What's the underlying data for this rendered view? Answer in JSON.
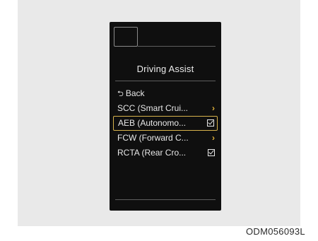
{
  "screen": {
    "title": "Driving Assist",
    "menu": [
      {
        "label": "Back",
        "icon": "back-arrow-icon",
        "trail": "none",
        "selected": false
      },
      {
        "label": "SCC (Smart Crui...",
        "trail": "chevron",
        "selected": false
      },
      {
        "label": "AEB (Autonomo...",
        "trail": "checkbox",
        "selected": true
      },
      {
        "label": "FCW (Forward C...",
        "trail": "chevron",
        "selected": false
      },
      {
        "label": "RCTA (Rear Cro...",
        "trail": "checkbox",
        "selected": false
      }
    ]
  },
  "figure_code": "ODM056093L",
  "colors": {
    "highlight": "#d6b24c",
    "chevron": "#e0b23a",
    "screen_bg": "#0f0f0f"
  }
}
